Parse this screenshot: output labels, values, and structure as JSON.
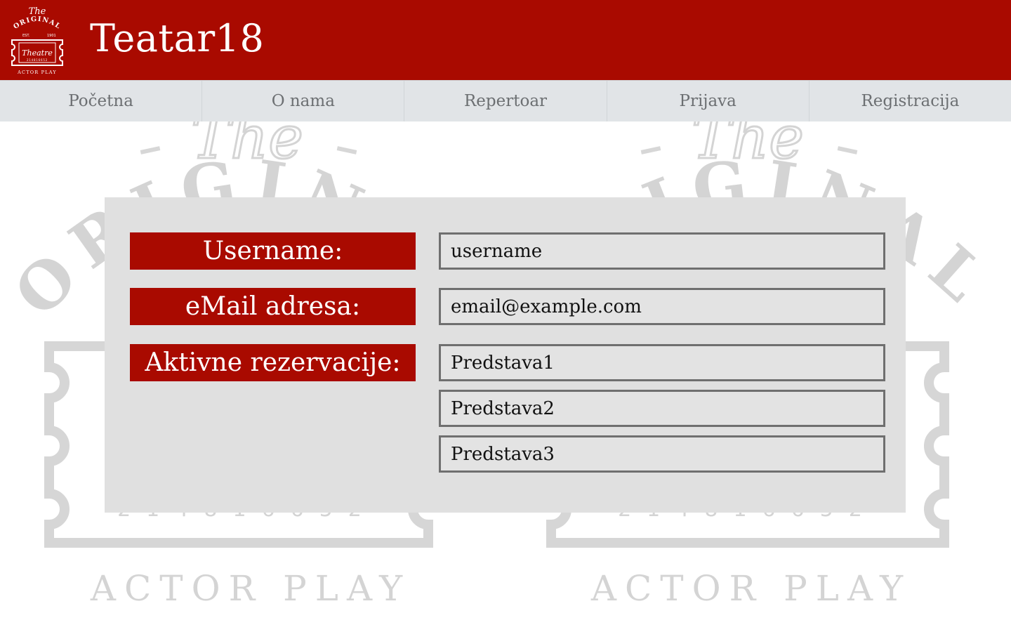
{
  "header": {
    "title": "Teatar18",
    "logo": {
      "top_script": "The",
      "arc_text": "ORIGINAL",
      "est": "EST.",
      "year": "1901",
      "center_script": "Theatre",
      "bottom_text": "ACTOR PLAY",
      "ticket_number": "214816652"
    }
  },
  "nav": {
    "items": [
      {
        "label": "Početna"
      },
      {
        "label": "O nama"
      },
      {
        "label": "Repertoar"
      },
      {
        "label": "Prijava"
      },
      {
        "label": "Registracija"
      }
    ]
  },
  "watermark": {
    "script": "The",
    "arc_text": "ORIGINAL",
    "bottom_text": "ACTOR PLAY",
    "ticket_number": "214816652"
  },
  "profile": {
    "username_label": "Username:",
    "username_value": "username",
    "email_label": "eMail adresa:",
    "email_value": "email@example.com",
    "reservations_label": "Aktivne rezervacije:",
    "reservations": [
      "Predstava1",
      "Predstava2",
      "Predstava3"
    ]
  },
  "colors": {
    "brand_red": "#a90a00",
    "nav_bg": "#e1e4e7",
    "panel_bg": "#e0e0e0",
    "watermark": "#d4d4d4"
  }
}
